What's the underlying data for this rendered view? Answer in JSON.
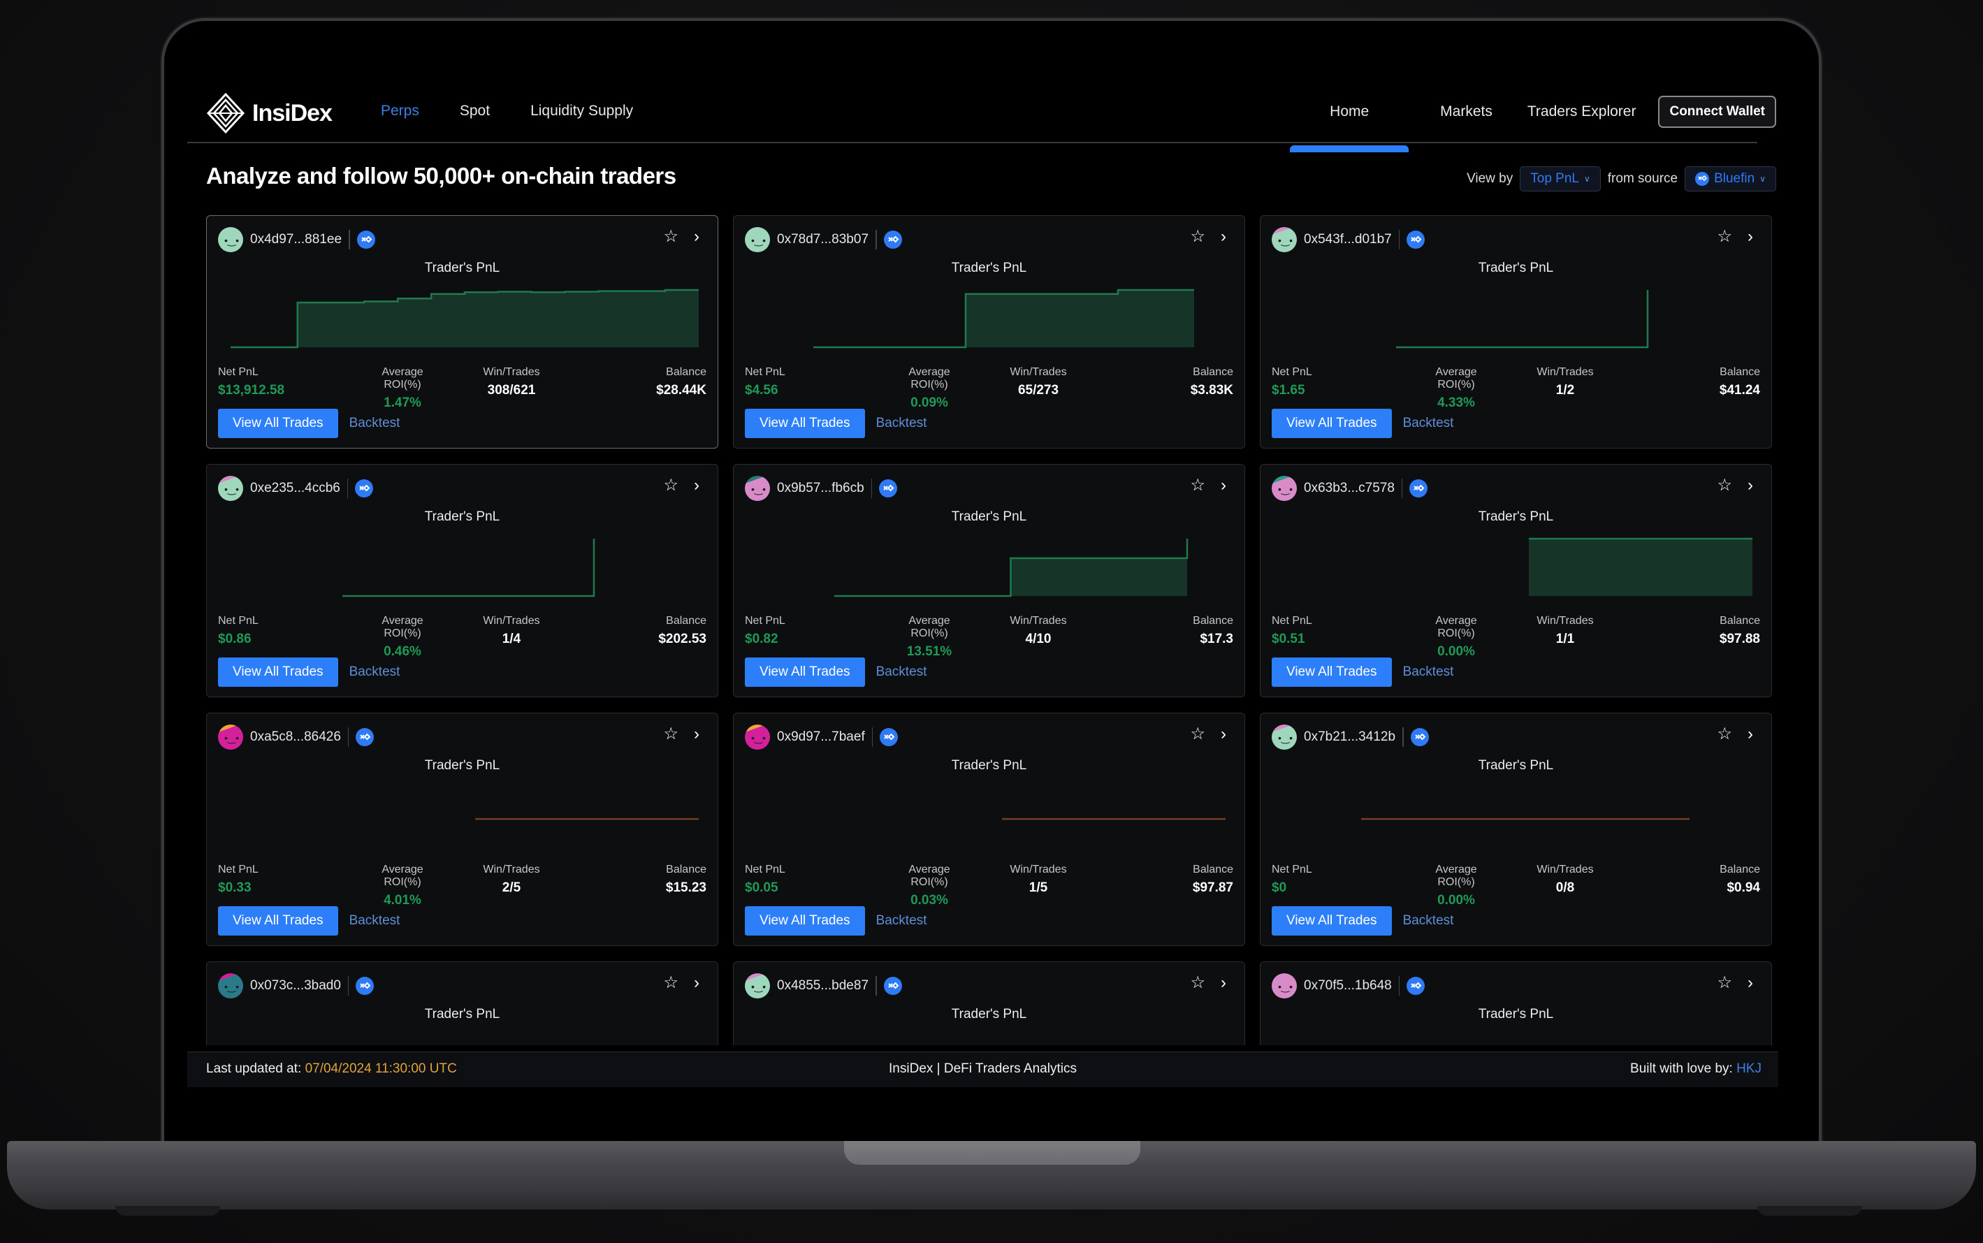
{
  "app": {
    "brand": "InsiDex",
    "nav_left": [
      {
        "label": "Perps",
        "active": true
      },
      {
        "label": "Spot",
        "active": false
      },
      {
        "label": "Liquidity Supply",
        "active": false
      }
    ],
    "nav_right": [
      {
        "label": "Home",
        "active": true
      },
      {
        "label": "Markets",
        "active": false
      },
      {
        "label": "Traders Explorer",
        "active": false
      }
    ],
    "connect_wallet": "Connect Wallet"
  },
  "page": {
    "title": "Analyze and follow 50,000+ on-chain traders",
    "view_by_label": "View by",
    "view_by_value": "Top PnL",
    "source_label": "from source",
    "source_value": "Bluefin"
  },
  "card_labels": {
    "chart_title": "Trader's PnL",
    "net_pnl": "Net PnL",
    "avg_roi": "Average ROI(%)",
    "win_trades": "Win/Trades",
    "balance": "Balance",
    "view_all": "View All Trades",
    "backtest": "Backtest"
  },
  "colors": {
    "accent": "#2d7ff9",
    "positive": "#1f9a57",
    "line_negative": "#7a3d1f",
    "timestamp": "#e1a43a"
  },
  "traders": [
    {
      "address": "0x4d97...881ee",
      "avatar": [
        "#9ed7bb",
        "#9ed7bb"
      ],
      "net_pnl": "$13,912.58",
      "avg_roi": "1.47%",
      "win_trades": "308/621",
      "balance": "$28.44K",
      "selected": true,
      "pnl_series": [
        0,
        0,
        0.78,
        0.78,
        0.8,
        0.85,
        0.93,
        0.96,
        0.97,
        0.96,
        0.97,
        0.98,
        0.98,
        1.0,
        1.0
      ]
    },
    {
      "address": "0x78d7...83b07",
      "avatar": [
        "#9ed7bb",
        "#9ed7bb"
      ],
      "net_pnl": "$4.56",
      "avg_roi": "0.09%",
      "win_trades": "65/273",
      "balance": "$3.83K",
      "selected": false,
      "pnl_series": [
        0,
        0,
        0.93,
        0.93,
        1.0,
        1.0
      ]
    },
    {
      "address": "0x543f...d01b7",
      "avatar": [
        "#9ed7bb",
        "#d98bc9"
      ],
      "net_pnl": "$1.65",
      "avg_roi": "4.33%",
      "win_trades": "1/2",
      "balance": "$41.24",
      "selected": false,
      "pnl_series": [
        0,
        0,
        1.0
      ]
    },
    {
      "address": "0xe235...4ccb6",
      "avatar": [
        "#9ed7bb",
        "#d98bc9"
      ],
      "net_pnl": "$0.86",
      "avg_roi": "0.46%",
      "win_trades": "1/4",
      "balance": "$202.53",
      "selected": false,
      "pnl_series": [
        0,
        0,
        1.0
      ]
    },
    {
      "address": "0x9b57...fb6cb",
      "avatar": [
        "#d98bc9",
        "#2a7a7a"
      ],
      "net_pnl": "$0.82",
      "avg_roi": "13.51%",
      "win_trades": "4/10",
      "balance": "$17.3",
      "selected": false,
      "pnl_series": [
        0,
        0,
        0.66,
        0.66,
        1.0
      ]
    },
    {
      "address": "0x63b3...c7578",
      "avatar": [
        "#d98bc9",
        "#2a9a8a"
      ],
      "net_pnl": "$0.51",
      "avg_roi": "0.00%",
      "win_trades": "1/1",
      "balance": "$97.88",
      "selected": false,
      "pnl_series": [
        1.0,
        1.0
      ]
    },
    {
      "address": "0xa5c8...86426",
      "avatar": [
        "#d4209a",
        "#f0a43a"
      ],
      "net_pnl": "$0.33",
      "avg_roi": "4.01%",
      "win_trades": "2/5",
      "balance": "$15.23",
      "selected": false,
      "pnl_series": [
        0,
        0
      ]
    },
    {
      "address": "0x9d97...7baef",
      "avatar": [
        "#d4209a",
        "#f0a43a"
      ],
      "net_pnl": "$0.05",
      "avg_roi": "0.03%",
      "win_trades": "1/5",
      "balance": "$97.87",
      "selected": false,
      "pnl_series": [
        0,
        0
      ]
    },
    {
      "address": "0x7b21...3412b",
      "avatar": [
        "#9ed7bb",
        "#d98bc9"
      ],
      "net_pnl": "$0",
      "avg_roi": "0.00%",
      "win_trades": "0/8",
      "balance": "$0.94",
      "selected": false,
      "pnl_series": [
        0,
        0
      ]
    },
    {
      "address": "0x073c...3bad0",
      "avatar": [
        "#2a7a8a",
        "#d4209a"
      ],
      "selected": false
    },
    {
      "address": "0x4855...bde87",
      "avatar": [
        "#9ed7bb",
        "#d98bc9"
      ],
      "selected": false
    },
    {
      "address": "0x70f5...1b648",
      "avatar": [
        "#d98bc9",
        "#d98bc9"
      ],
      "selected": false
    }
  ],
  "footer": {
    "last_updated_label": "Last updated at:",
    "last_updated_value": "07/04/2024 11:30:00 UTC",
    "center": "InsiDex | DeFi Traders Analytics",
    "built_by_label": "Built with love by:",
    "built_by_value": "HKJ"
  }
}
